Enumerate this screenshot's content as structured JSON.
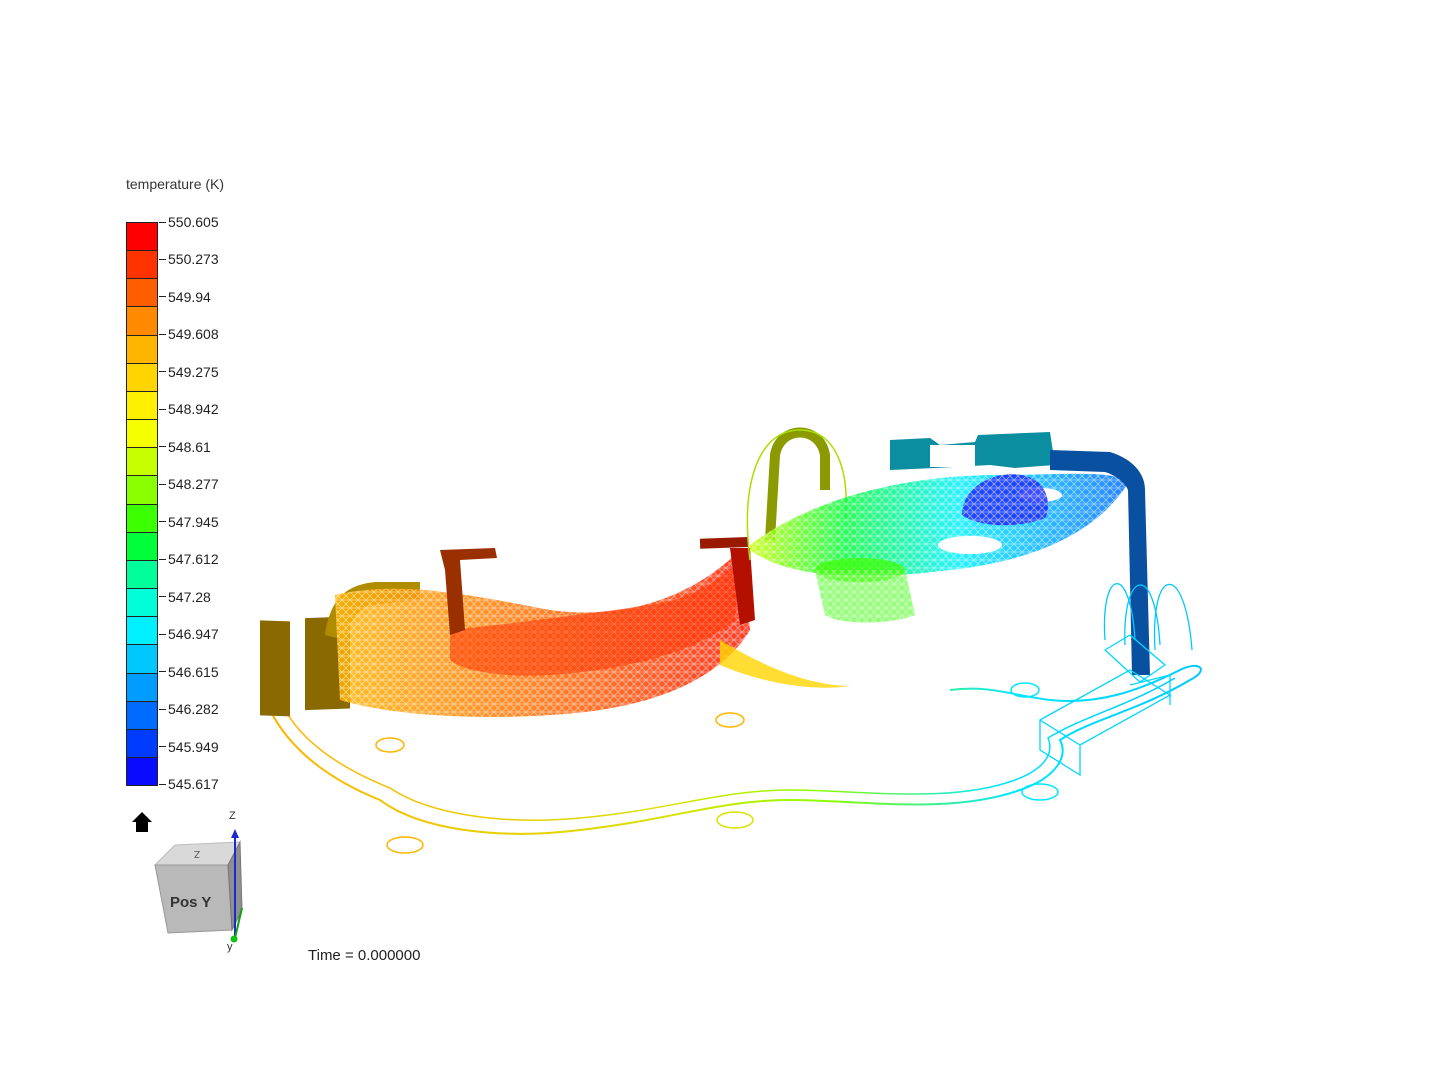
{
  "legend": {
    "title": "temperature (K)",
    "ticks": [
      "550.605",
      "550.273",
      "549.94",
      "549.608",
      "549.275",
      "548.942",
      "548.61",
      "548.277",
      "547.945",
      "547.612",
      "547.28",
      "546.947",
      "546.615",
      "546.282",
      "545.949",
      "545.617"
    ],
    "colors": [
      "#ff0000",
      "#ff3300",
      "#ff5e00",
      "#ff8a00",
      "#ffb400",
      "#ffd400",
      "#ffef00",
      "#f6ff00",
      "#c8ff00",
      "#8aff00",
      "#3cff00",
      "#00ff3a",
      "#00ff9a",
      "#00ffd8",
      "#00f0ff",
      "#00c8ff",
      "#009cff",
      "#006cff",
      "#003cff",
      "#0a0aff"
    ]
  },
  "orientation": {
    "face_label": "Pos Y",
    "top_face_label": "Z",
    "axis_z": "Z",
    "axis_y": "y"
  },
  "time": "Time = 0.000000",
  "icons": {
    "home": "home-icon"
  }
}
